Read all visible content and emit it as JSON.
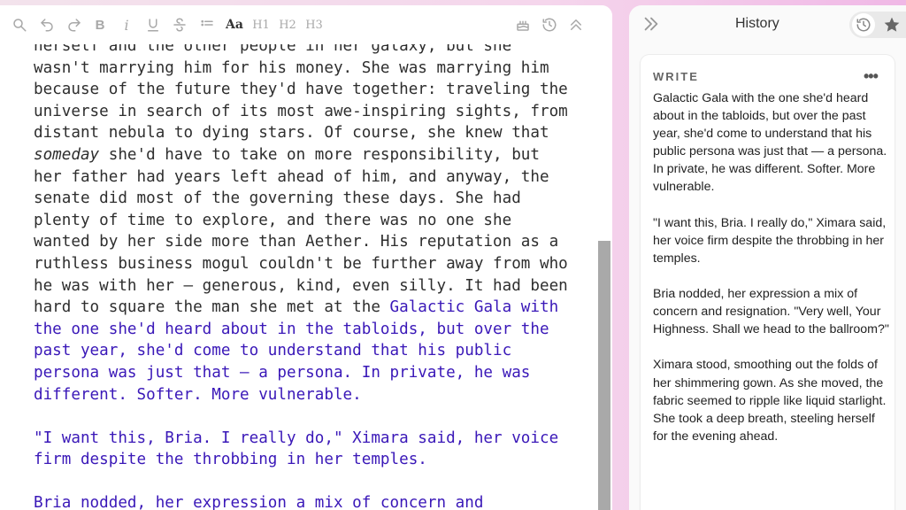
{
  "toolbar": {
    "items": [
      {
        "name": "search-icon"
      },
      {
        "name": "undo-icon"
      },
      {
        "name": "redo-icon"
      },
      {
        "name": "bold-button",
        "label": "B"
      },
      {
        "name": "italic-button",
        "label": "i"
      },
      {
        "name": "underline-icon"
      },
      {
        "name": "strikethrough-icon"
      },
      {
        "name": "list-icon"
      },
      {
        "name": "font-style-button",
        "label": "Aa"
      },
      {
        "name": "heading1-button",
        "label": "H1"
      },
      {
        "name": "heading2-button",
        "label": "H2"
      },
      {
        "name": "heading3-button",
        "label": "H3"
      }
    ],
    "right": [
      "cake-icon",
      "history-icon",
      "double-chevron-up-icon"
    ]
  },
  "document": {
    "paragraph1_plain": "herself and the other people in her galaxy, but she wasn't marrying him for his money. She was marrying him because of the future they'd have together: traveling the universe in search of its most awe-inspiring sights, from distant nebula to dying stars. Of course, she knew that ",
    "paragraph1_em": "someday",
    "paragraph1_plain2": " she'd have to take on more responsibility, but her father had years left ahead of him, and anyway, the senate did most of the governing these days. She had plenty of time to explore, and there was no one she wanted by her side more than Aether. His reputation as a ruthless business mogul couldn't be further away from who he was with her — generous, kind, even silly. It had been hard to square the man she met at the ",
    "paragraph1_highlight": "Galactic Gala with the one she'd heard about in the tabloids, but over the past year, she'd come to understand that his public persona was just that — a persona. In private, he was different. Softer. More vulnerable.",
    "paragraph2": "\"I want this, Bria. I really do,\" Ximara said, her voice firm despite the throbbing in her temples.",
    "paragraph3": "Bria nodded, her expression a mix of concern and"
  },
  "history": {
    "title": "History",
    "card": {
      "label": "WRITE",
      "menu": "•••",
      "paragraphs": [
        "Galactic Gala with the one she'd heard about in the tabloids, but over the past year, she'd come to understand that his public persona was just that — a persona. In private, he was different. Softer. More vulnerable.",
        "\"I want this, Bria. I really do,\" Ximara said, her voice firm despite the throbbing in her temples.",
        "Bria nodded, her expression a mix of concern and resignation. \"Very well, Your Highness. Shall we head to the ballroom?\"",
        "Ximara stood, smoothing out the folds of her shimmering gown. As she moved, the fabric seemed to ripple like liquid starlight. She took a deep breath, steeling herself for the evening ahead."
      ]
    }
  },
  "colors": {
    "highlight_text": "#3a18b8",
    "background_gradient_end": "#f0b8e6"
  }
}
